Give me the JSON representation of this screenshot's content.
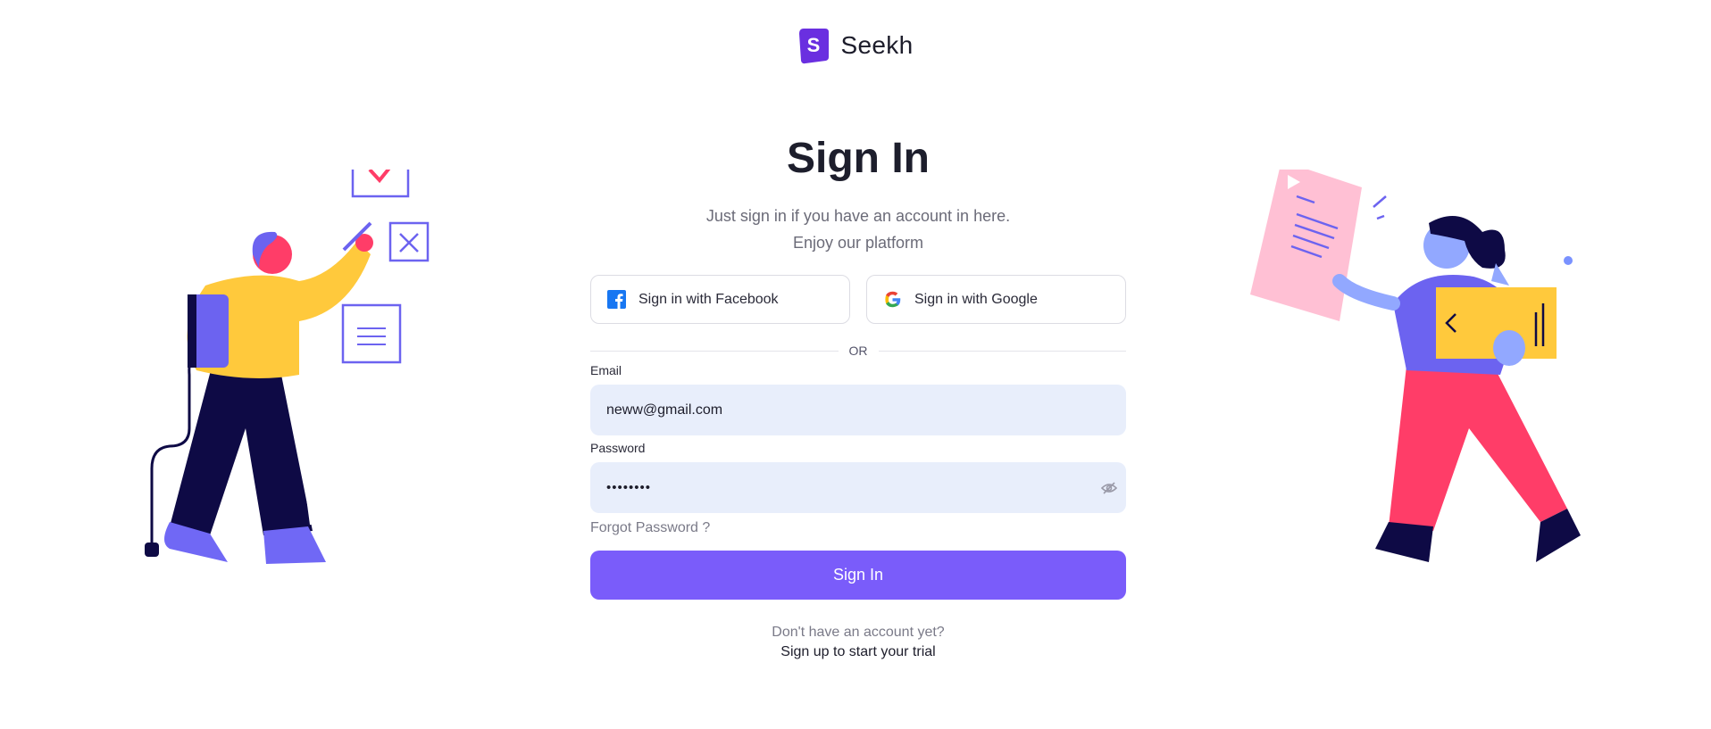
{
  "brand": {
    "name": "Seekh",
    "logo_letter": "S",
    "logo_color": "#6a2fe0"
  },
  "signin": {
    "title": "Sign In",
    "subtitle_line1": "Just sign in if you have an account in here.",
    "subtitle_line2": "Enjoy our platform"
  },
  "social": {
    "facebook_label": "Sign in with Facebook",
    "google_label": "Sign in with Google"
  },
  "divider_text": "OR",
  "form": {
    "email_label": "Email",
    "email_value": "neww@gmail.com",
    "password_label": "Password",
    "password_value": "••••••••",
    "forgot_label": "Forgot Password ?",
    "submit_label": "Sign In"
  },
  "signup": {
    "question": "Don't have an account yet?",
    "link_label": "Sign up to start your trial"
  },
  "colors": {
    "accent": "#7a5cfa",
    "input_bg": "#e8eefb",
    "yellow": "#ffc93c",
    "pink": "#ff3d68",
    "navy": "#0e0a45"
  }
}
